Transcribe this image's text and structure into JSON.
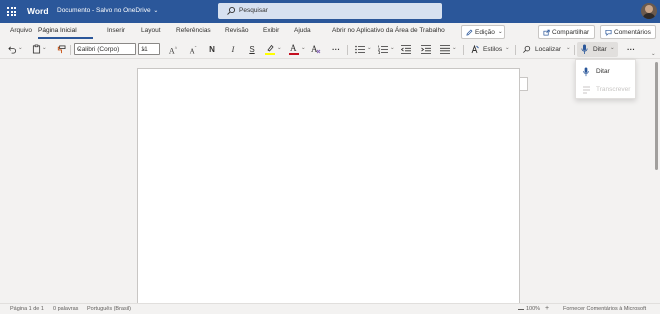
{
  "titlebar": {
    "app_name": "Word",
    "document_title": "Documento - Salvo no OneDrive",
    "search_placeholder": "Pesquisar"
  },
  "menu": {
    "tabs": [
      {
        "label": "Arquivo"
      },
      {
        "label": "Página Inicial",
        "active": true
      },
      {
        "label": "Inserir"
      },
      {
        "label": "Layout"
      },
      {
        "label": "Referências"
      },
      {
        "label": "Revisão"
      },
      {
        "label": "Exibir"
      },
      {
        "label": "Ajuda"
      },
      {
        "label": "Abrir no Aplicativo da Área de Trabalho"
      }
    ],
    "editing_label": "Edição",
    "share_label": "Compartilhar",
    "comments_label": "Comentários"
  },
  "ribbon": {
    "font_name": "Calibri (Corpo)",
    "font_size": "11",
    "bold": "N",
    "italic": "I",
    "underline": "S",
    "styles_label": "Estilos",
    "find_label": "Localizar",
    "dictate_label": "Ditar",
    "more_label": "···"
  },
  "dictate_menu": {
    "items": [
      {
        "label": "Ditar",
        "enabled": true
      },
      {
        "label": "Transcrever",
        "enabled": false
      }
    ]
  },
  "statusbar": {
    "page": "Página 1 de 1",
    "words": "0 palavras",
    "language": "Português (Brasil)",
    "zoom": "100%",
    "feedback": "Fornecer Comentários à Microsoft"
  },
  "colors": {
    "brand": "#2b579a",
    "highlight": "#ffff00",
    "font_color": "#c50f1f"
  }
}
